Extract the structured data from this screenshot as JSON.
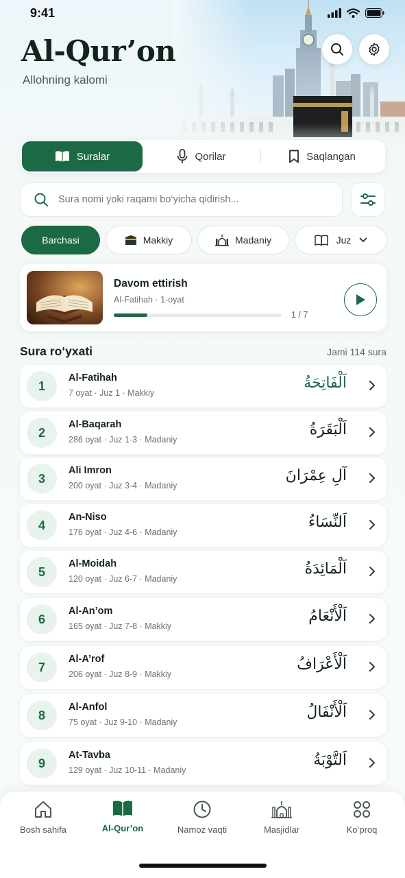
{
  "status_bar": {
    "time": "9:41"
  },
  "header": {
    "title": "Al-Qur’on",
    "subtitle": "Allohning kalomi"
  },
  "tabs": [
    {
      "label": "Suralar",
      "icon": "open-book-icon",
      "active": true
    },
    {
      "label": "Qorilar",
      "icon": "microphone-icon",
      "active": false
    },
    {
      "label": "Saqlangan",
      "icon": "bookmark-icon",
      "active": false
    }
  ],
  "search": {
    "placeholder": "Sura nomi yoki raqami bo‘yicha qidirish..."
  },
  "chips": [
    {
      "label": "Barchasi",
      "active": true
    },
    {
      "label": "Makkiy",
      "icon": "kaaba-icon"
    },
    {
      "label": "Madaniy",
      "icon": "mosque-icon"
    },
    {
      "label": "Juz",
      "icon": "book-icon"
    }
  ],
  "continue_card": {
    "title": "Davom ettirish",
    "surah": "Al-Fatihah",
    "ayah": "1-oyat",
    "progress_text": "1 / 7",
    "progress": 0.2
  },
  "list": {
    "title": "Sura ro‘yxati",
    "count": "Jami 114 sura",
    "surahs": [
      {
        "number": "1",
        "name": "Al-Fatihah",
        "ayahs": "7 oyat",
        "juz": "Juz 1",
        "type": "Makkiy",
        "arabic": "اَلْفَاتِحَةُ"
      },
      {
        "number": "2",
        "name": "Al-Baqarah",
        "ayahs": "286 oyat",
        "juz": "Juz 1-3",
        "type": "Madaniy",
        "arabic": "اَلْبَقَرَةُ"
      },
      {
        "number": "3",
        "name": "Ali Imron",
        "ayahs": "200 oyat",
        "juz": "Juz 3-4",
        "type": "Madaniy",
        "arabic": "آلِ عِمْرَانَ"
      },
      {
        "number": "4",
        "name": "An-Niso",
        "ayahs": "176 oyat",
        "juz": "Juz 4-6",
        "type": "Madaniy",
        "arabic": "اَلنِّسَاءُ"
      },
      {
        "number": "5",
        "name": "Al-Moidah",
        "ayahs": "120 oyat",
        "juz": "Juz 6-7",
        "type": "Madaniy",
        "arabic": "اَلْمَائِدَةُ"
      },
      {
        "number": "6",
        "name": "Al-An’om",
        "ayahs": "165 oyat",
        "juz": "Juz 7-8",
        "type": "Makkiy",
        "arabic": "اَلْأَنْعَامُ"
      },
      {
        "number": "7",
        "name": "Al-A’rof",
        "ayahs": "206 oyat",
        "juz": "Juz 8-9",
        "type": "Makkiy",
        "arabic": "اَلْأَعْرَافُ"
      },
      {
        "number": "8",
        "name": "Al-Anfol",
        "ayahs": "75 oyat",
        "juz": "Juz 9-10",
        "type": "Madaniy",
        "arabic": "اَلْأَنْفَالُ"
      },
      {
        "number": "9",
        "name": "At-Tavba",
        "ayahs": "129 oyat",
        "juz": "Juz 10-11",
        "type": "Madaniy",
        "arabic": "اَلتَّوْبَةُ"
      }
    ]
  },
  "bottom_nav": [
    {
      "label": "Bosh sahifa",
      "icon": "home-icon",
      "active": false
    },
    {
      "label": "Al-Qur’on",
      "icon": "quran-book-icon",
      "active": true
    },
    {
      "label": "Namoz vaqti",
      "icon": "clock-icon",
      "active": false
    },
    {
      "label": "Masjidlar",
      "icon": "mosque-icon",
      "active": false
    },
    {
      "label": "Ko‘proq",
      "icon": "grid-icon",
      "active": false
    }
  ],
  "colors": {
    "primary": "#1b6a45",
    "primary_light": "#e8f3ee",
    "text": "#14221c"
  }
}
